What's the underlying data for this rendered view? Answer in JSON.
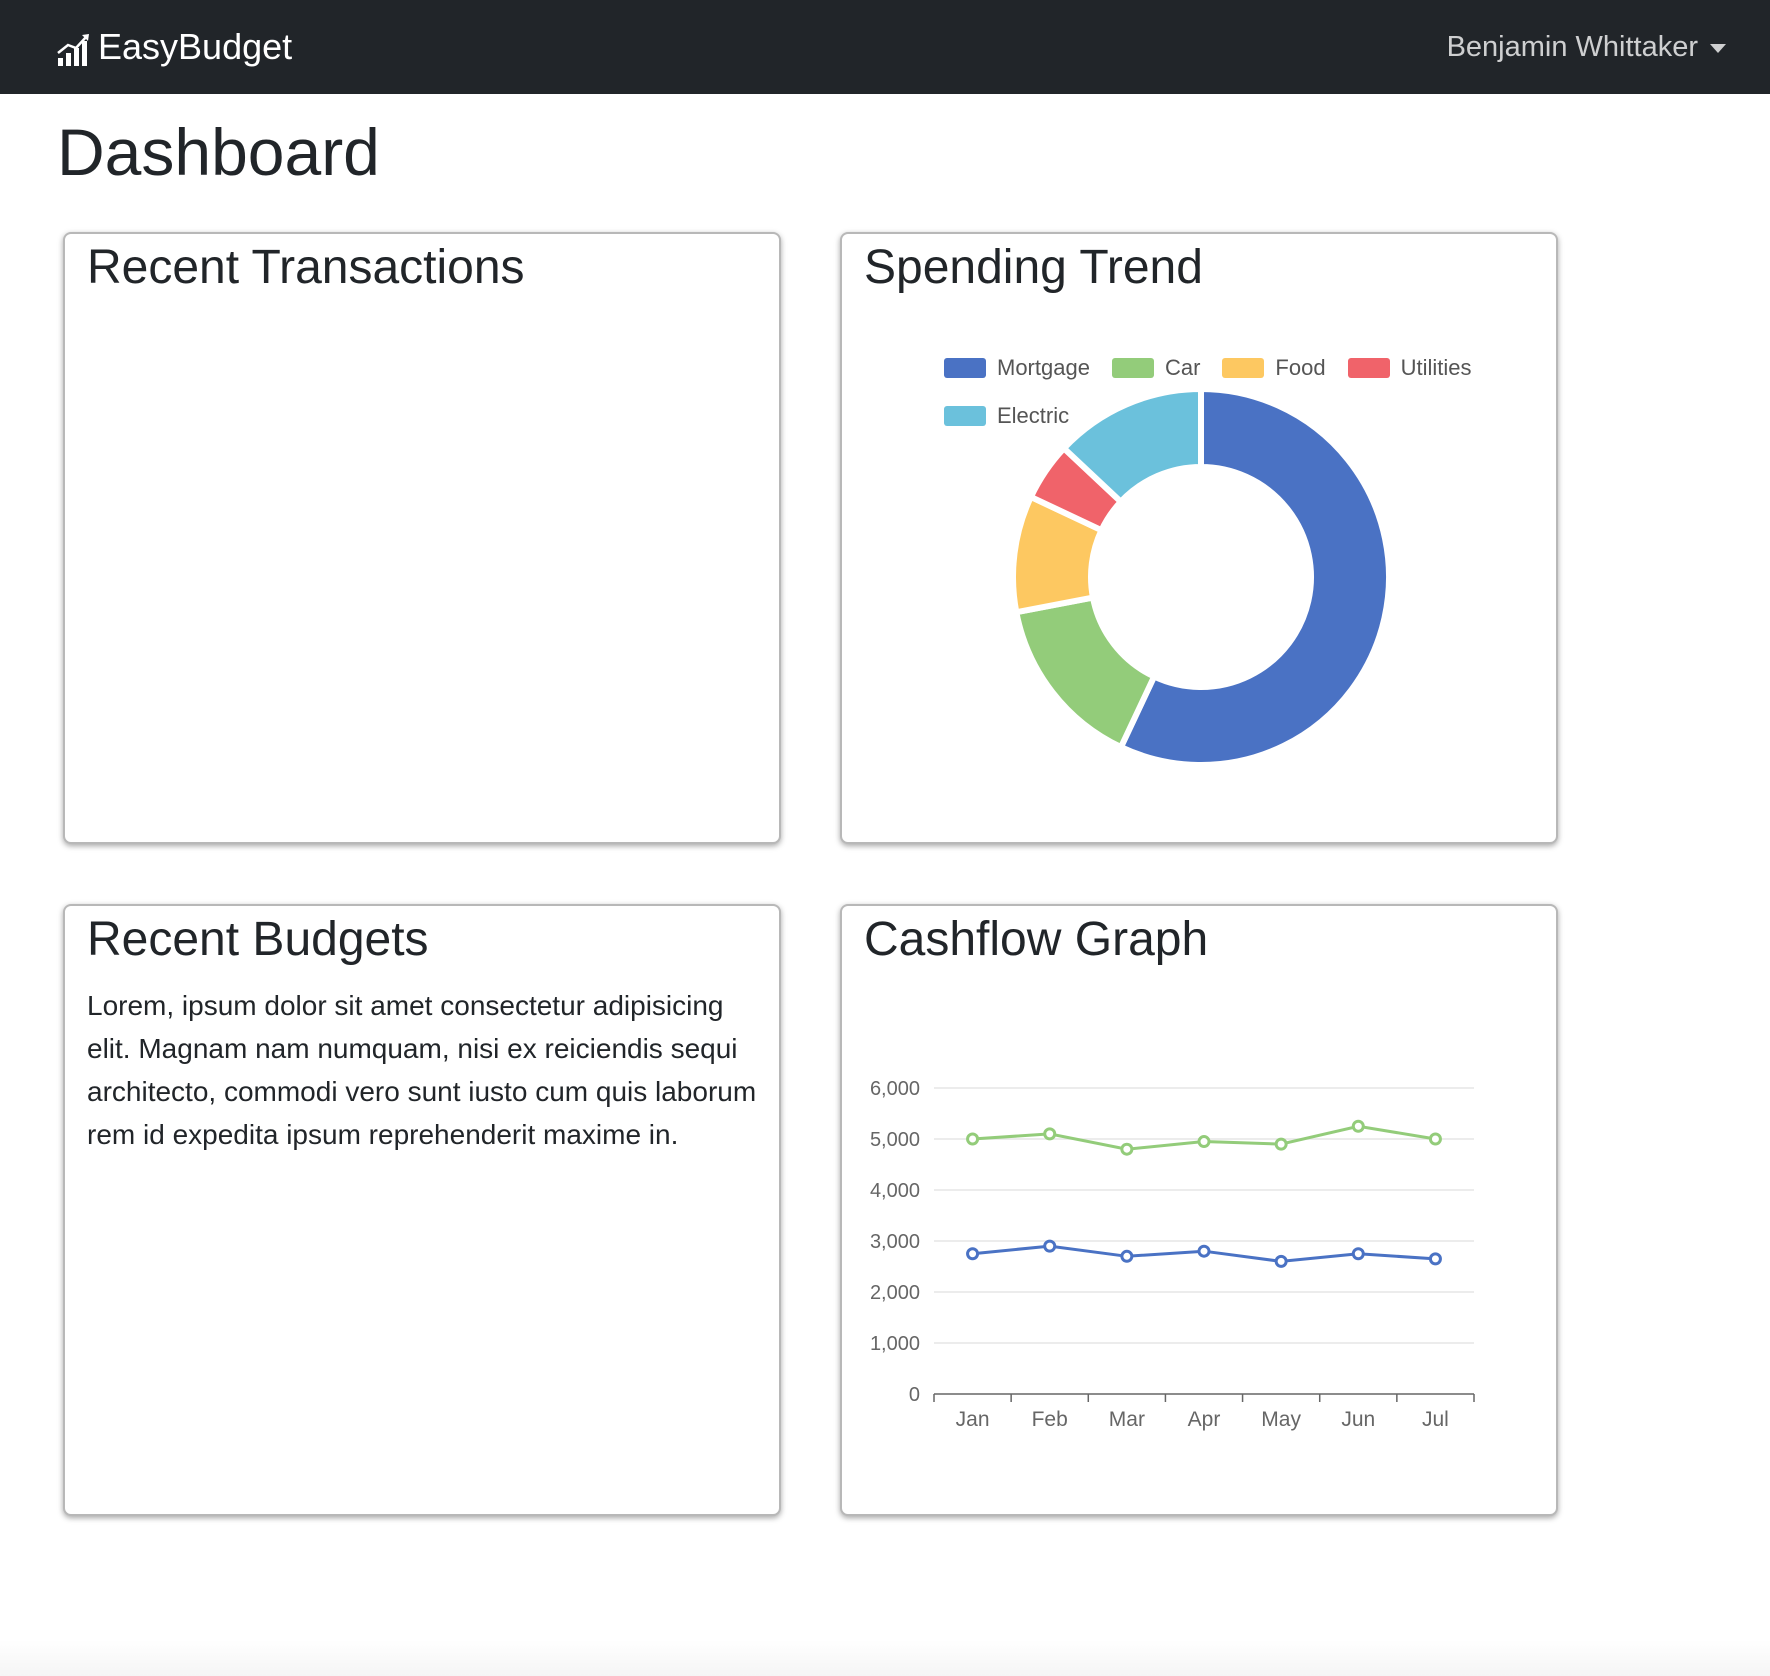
{
  "navbar": {
    "brand": "EasyBudget",
    "brand_icon": "bar-chart-icon",
    "user_name": "Benjamin Whittaker",
    "user_menu_icon": "caret-down-icon"
  },
  "page": {
    "title": "Dashboard"
  },
  "cards": {
    "transactions": {
      "title": "Recent Transactions"
    },
    "spending": {
      "title": "Spending Trend"
    },
    "budgets": {
      "title": "Recent Budgets",
      "body": "Lorem, ipsum dolor sit amet consectetur adipisicing elit. Magnam nam numquam, nisi ex reiciendis sequi architecto, commodi vero sunt iusto cum quis laborum rem id expedita ipsum reprehenderit maxime in."
    },
    "cashflow": {
      "title": "Cashflow Graph"
    }
  },
  "chart_data": [
    {
      "type": "pie",
      "variant": "doughnut",
      "title": "",
      "labels": [
        "Mortgage",
        "Car",
        "Food",
        "Utilities",
        "Electric"
      ],
      "values": [
        57,
        15,
        10,
        5,
        13
      ],
      "colors": [
        "#4a72c4",
        "#93cc7a",
        "#fdc861",
        "#f0636a",
        "#6bc1dc"
      ],
      "legend": "top"
    },
    {
      "type": "line",
      "title": "",
      "categories": [
        "Jan",
        "Feb",
        "Mar",
        "Apr",
        "May",
        "Jun",
        "Jul"
      ],
      "series": [
        {
          "values": [
            5000,
            5100,
            4800,
            4950,
            4900,
            5250,
            5000
          ],
          "color": "#93cc7a"
        },
        {
          "values": [
            2750,
            2900,
            2700,
            2800,
            2600,
            2750,
            2650
          ],
          "color": "#4a72c4"
        }
      ],
      "y_ticks": [
        0,
        1000,
        2000,
        3000,
        4000,
        5000,
        6000
      ],
      "y_tick_labels": [
        "0",
        "1,000",
        "2,000",
        "3,000",
        "4,000",
        "5,000",
        "6,000"
      ],
      "ylim": [
        0,
        6000
      ],
      "grid": true,
      "xlabel": "",
      "ylabel": ""
    }
  ]
}
